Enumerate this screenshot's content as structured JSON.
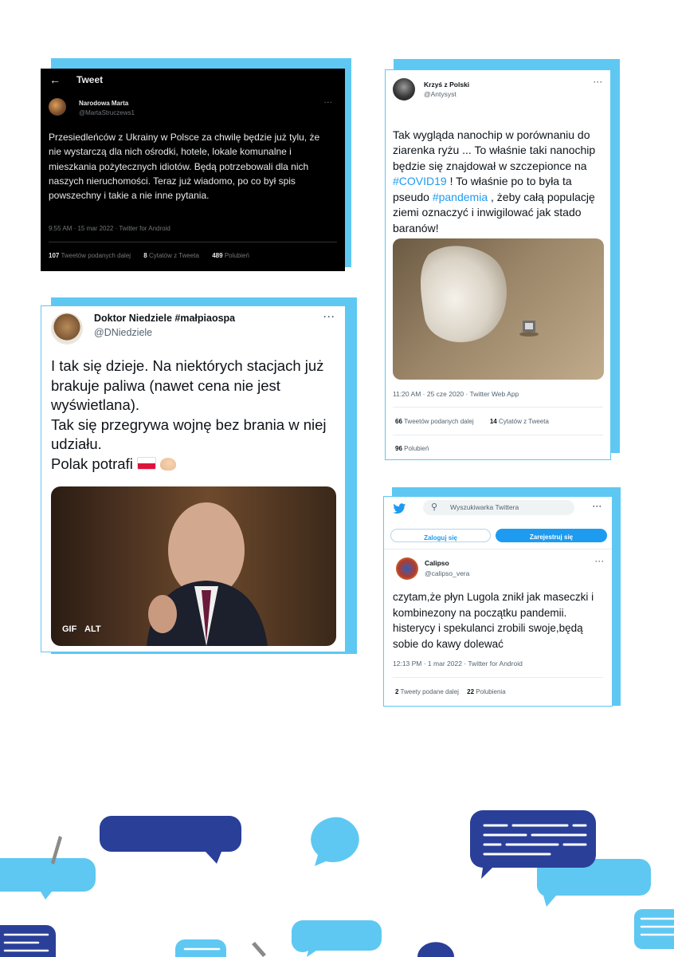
{
  "tweet1": {
    "header_title": "Tweet",
    "name": "Narodowa Marta",
    "handle": "@MartaStruczews1",
    "text": "Przesiedleńców z Ukrainy w Polsce za chwilę będzie już tylu, że nie wystarczą dla nich ośrodki, hotele, lokale komunalne i mieszkania pożytecznych idiotów. Będą potrzebowali dla nich naszych nieruchomości. Teraz już wiadomo, po co był spis powszechny i takie a nie inne pytania.",
    "meta": "9:55 AM · 15 mar 2022 · Twitter for Android",
    "stats": [
      {
        "count": "107",
        "label": "Tweetów podanych dalej"
      },
      {
        "count": "8",
        "label": "Cytatów z Tweeta"
      },
      {
        "count": "489",
        "label": "Polubień"
      }
    ]
  },
  "tweet2": {
    "name": "Krzyś z Polski",
    "handle": "@Antysyst",
    "text_parts": [
      "Tak wygląda nanochip w porównaniu do ziarenka ryżu ... To właśnie taki nanochip będzie się znajdował w szczepionce na ",
      "#COVID19",
      " ! To właśnie po to była ta pseudo ",
      "#pandemia",
      " , żeby całą populację ziemi oznaczyć i inwigilować jak stado baranów!"
    ],
    "meta": "11:20 AM · 25 cze 2020 · Twitter Web App",
    "stats": [
      {
        "count": "66",
        "label": "Tweetów podanych dalej"
      },
      {
        "count": "14",
        "label": "Cytatów z Tweeta"
      },
      {
        "count": "96",
        "label": "Polubień"
      }
    ]
  },
  "tweet3": {
    "name": "Doktor Niedziele #małpiaospa",
    "handle": "@DNiedziele",
    "text": "I tak się dzieje. Na niektórych stacjach już brakuje paliwa (nawet cena nie jest wyświetlana).\nTak się przegrywa wojnę bez brania w niej udziału.\nPolak potrafi",
    "gif_label": "GIF",
    "alt_label": "ALT"
  },
  "tweet4": {
    "search_placeholder": "Wyszukiwarka Twittera",
    "login_label": "Zaloguj się",
    "signup_label": "Zarejestruj się",
    "name": "Calipso",
    "handle": "@calipso_vera",
    "text": "czytam,że płyn Lugola znikł jak maseczki i kombinezony na początku pandemii. histerycy i spekulanci zrobili swoje,będą sobie do kawy dolewać",
    "meta": "12:13 PM · 1 mar 2022 · Twitter for Android",
    "stats": [
      {
        "count": "2",
        "label": "Tweety podane dalej"
      },
      {
        "count": "22",
        "label": "Polubienia"
      }
    ]
  },
  "more_label": "···",
  "colors": {
    "accent": "#5ec8f2",
    "navy": "#2a3f98",
    "twitter": "#1d9bf0"
  }
}
